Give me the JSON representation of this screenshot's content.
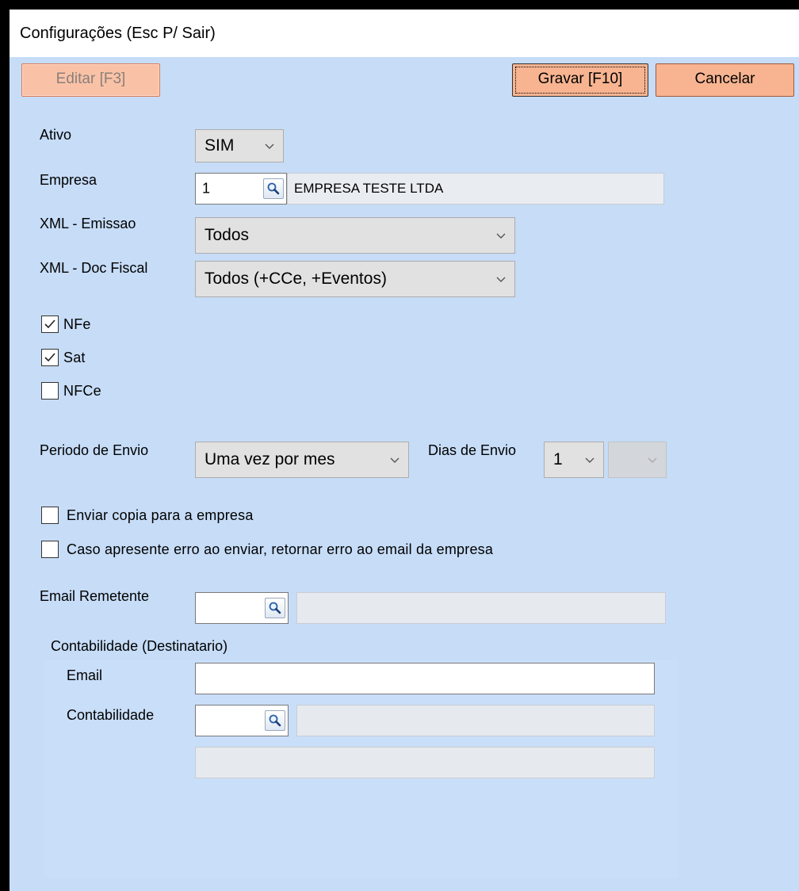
{
  "window": {
    "title": "Configurações (Esc P/ Sair)"
  },
  "toolbar": {
    "edit_label": "Editar [F3]",
    "save_label": "Gravar [F10]",
    "cancel_label": "Cancelar"
  },
  "form": {
    "ativo": {
      "label": "Ativo",
      "value": "SIM"
    },
    "empresa": {
      "label": "Empresa",
      "code": "1",
      "name": "EMPRESA TESTE LTDA"
    },
    "xml_emissao": {
      "label": "XML - Emissao",
      "value": "Todos"
    },
    "xml_doc_fiscal": {
      "label": "XML - Doc Fiscal",
      "value": "Todos (+CCe, +Eventos)"
    },
    "checks": [
      {
        "label": "NFe",
        "checked": true
      },
      {
        "label": "Sat",
        "checked": true
      },
      {
        "label": "NFCe",
        "checked": false
      }
    ],
    "periodo_envio": {
      "label": "Periodo de Envio",
      "value": "Uma vez por mes"
    },
    "dias_envio": {
      "label": "Dias de Envio",
      "value": "1",
      "value2": ""
    },
    "enviar_copia": {
      "label": "Enviar copia para a empresa",
      "checked": false
    },
    "retornar_erro": {
      "label": "Caso apresente erro ao enviar, retornar erro ao email da empresa",
      "checked": false
    },
    "email_remetente": {
      "label": "Email Remetente",
      "code": "",
      "name": ""
    },
    "contabilidade_group": {
      "title": "Contabilidade (Destinatario)",
      "email": {
        "label": "Email",
        "value": ""
      },
      "contabilidade": {
        "label": "Contabilidade",
        "code": "",
        "name": "",
        "extra": ""
      }
    }
  },
  "icons": {
    "lookup": "magnifier-icon",
    "dropdown": "chevron-down-icon",
    "check": "check-icon"
  }
}
